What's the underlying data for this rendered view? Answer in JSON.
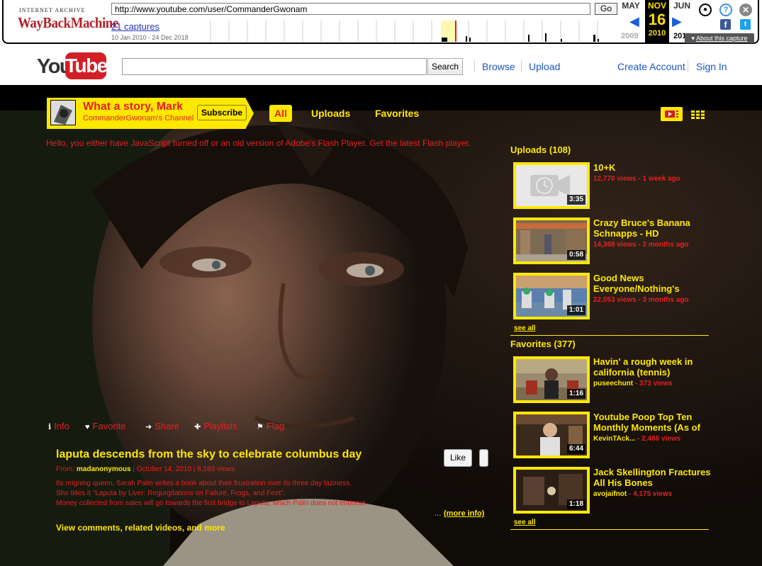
{
  "wayback": {
    "logo_line1": "INTERNET ARCHIVE",
    "logo_line2": "WayBackMachine",
    "url": "http://www.youtube.com/user/CommanderGwonam",
    "go_label": "Go",
    "captures": "21 captures",
    "range": "10 Jan 2010 - 24 Dec 2018",
    "month_prev": "MAY",
    "month_cur": "NOV",
    "month_next": "JUN",
    "day": "16",
    "year_prev": "2009",
    "year_cur": "2010",
    "year_next": "201",
    "about": "About this capture"
  },
  "header": {
    "logo_you": "You",
    "logo_tube": "Tube",
    "search_button": "Search",
    "browse": "Browse",
    "upload": "Upload",
    "create_account": "Create Account",
    "sign_in": "Sign In"
  },
  "channel": {
    "title": "What a story, Mark",
    "subtitle": "CommanderGwonam's Channel",
    "subscribe": "Subscribe",
    "tabs": [
      "All",
      "Uploads",
      "Favorites"
    ],
    "flash_msg": "Hello, you either have JavaScript turned off or an old version of Adobe's Flash Player. Get the latest Flash player."
  },
  "video": {
    "actions": [
      "Info",
      "Favorite",
      "Share",
      "Playlists",
      "Flag"
    ],
    "title": "laputa descends from the sky to celebrate columbus day",
    "from_label": "From:",
    "author": "madanonymous",
    "date": "October 14, 2010",
    "views": "8,169 views",
    "desc1": "Its reigning queen, Sarah Palin writes a book about their frustration over its three day laziness.",
    "desc2": "She titles it \"Laputa by Liver: Regurgitations on Failure, Frogs, and Feet\".",
    "desc3": "Money collected from sales will go towards the first bridge to Laputa, which Palin does not endorse.",
    "more_info": "(more info)",
    "view_more": "View comments, related videos, and more",
    "like": "Like"
  },
  "uploads": {
    "heading": "Uploads (108)",
    "see_all": "see all",
    "items": [
      {
        "title": "10+K",
        "meta": "12,770 views - 1 week ago",
        "duration": "3:35"
      },
      {
        "title": "Crazy Bruce's Banana Schnapps - HD",
        "meta": "14,368 views - 2 months ago",
        "duration": "0:58"
      },
      {
        "title": "Good News Everyone/Nothing's",
        "meta": "22,053 views - 3 months ago",
        "duration": "1:01"
      }
    ]
  },
  "favorites": {
    "heading": "Favorites (377)",
    "see_all": "see all",
    "items": [
      {
        "title": "Havin' a rough week in california (tennis)",
        "author": "puseechunt",
        "views": "- 373 views",
        "duration": "1:16"
      },
      {
        "title": "Youtube Poop Top Ten Monthly Moments (As of",
        "author": "KevinTAck...",
        "views": "- 2,486 views",
        "duration": "6:44"
      },
      {
        "title": "Jack Skellington Fractures All His Bones",
        "author": "avojaifnot",
        "views": "- 4,175 views",
        "duration": "1:18"
      }
    ]
  }
}
